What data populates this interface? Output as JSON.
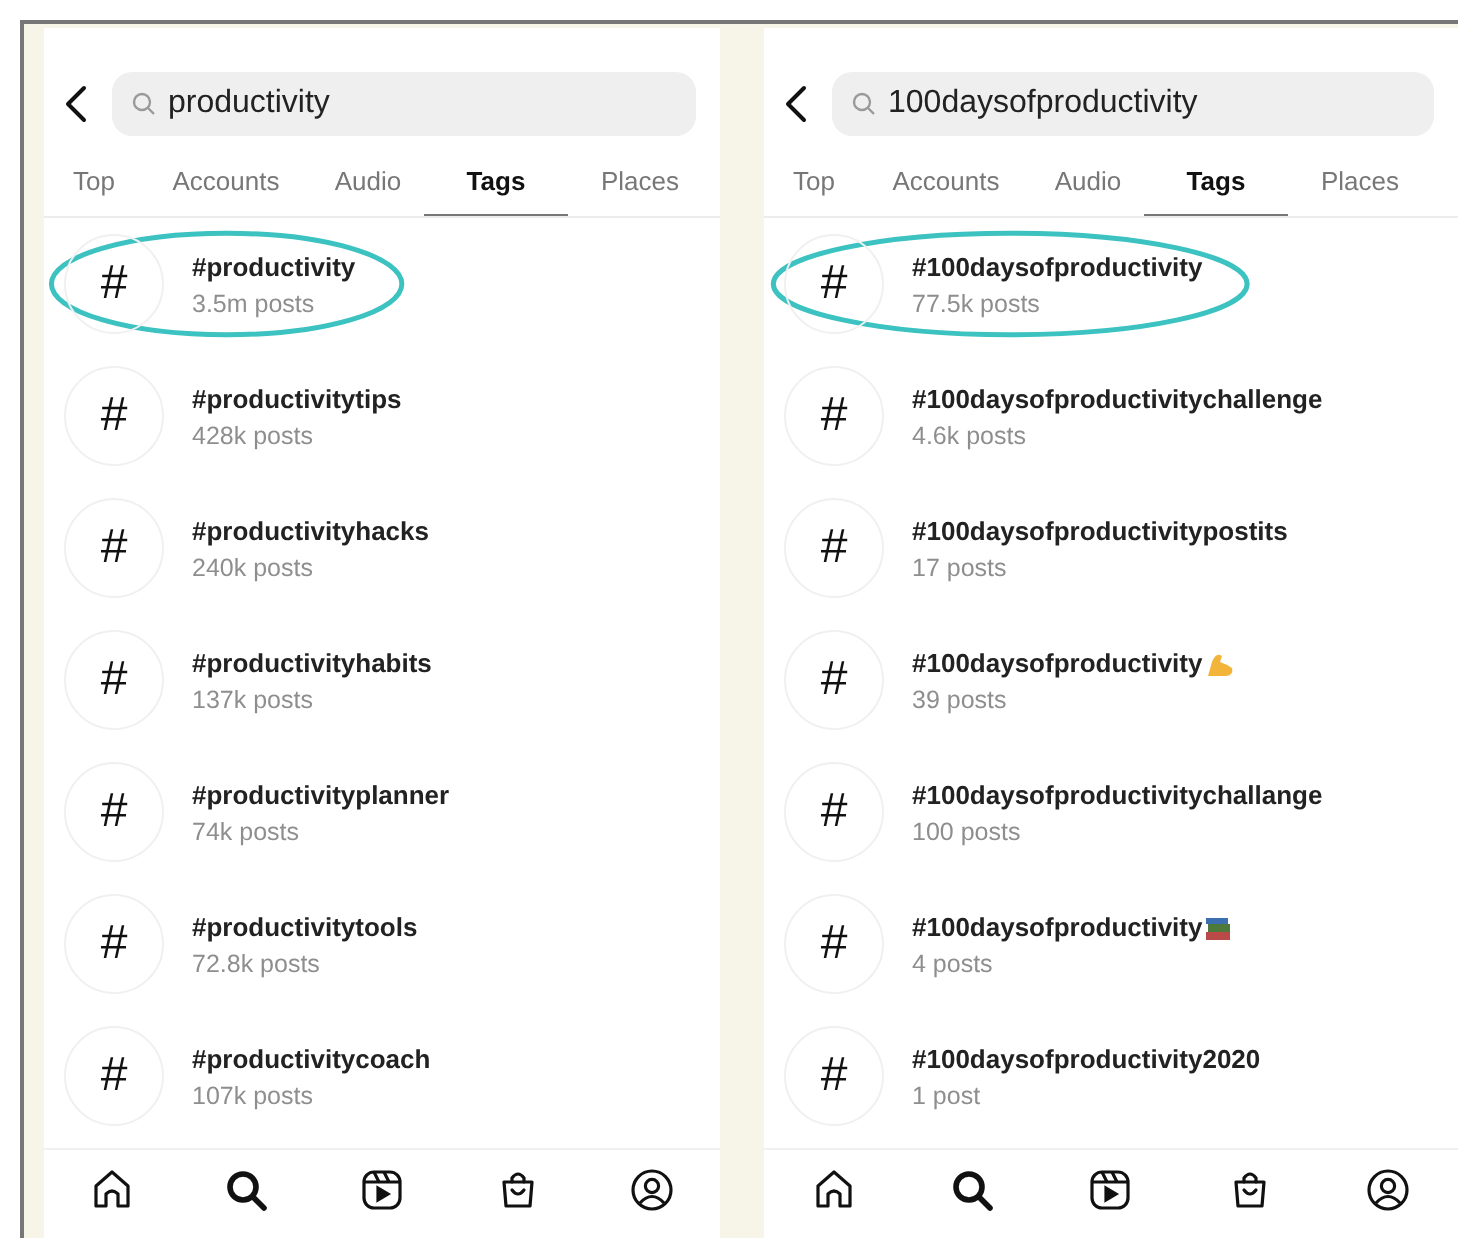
{
  "screens": [
    {
      "search": {
        "value": "productivity"
      },
      "tabs": [
        {
          "label": "Top",
          "selected": false
        },
        {
          "label": "Accounts",
          "selected": false
        },
        {
          "label": "Audio",
          "selected": false
        },
        {
          "label": "Tags",
          "selected": true
        },
        {
          "label": "Places",
          "selected": false
        }
      ],
      "tags": [
        {
          "symbol": "#",
          "name": "#productivity",
          "posts": "3.5m posts",
          "circled": true
        },
        {
          "symbol": "#",
          "name": "#productivitytips",
          "posts": "428k posts",
          "circled": false
        },
        {
          "symbol": "#",
          "name": "#productivityhacks",
          "posts": "240k posts",
          "circled": false
        },
        {
          "symbol": "#",
          "name": "#productivityhabits",
          "posts": "137k posts",
          "circled": false
        },
        {
          "symbol": "#",
          "name": "#productivityplanner",
          "posts": "74k posts",
          "circled": false
        },
        {
          "symbol": "#",
          "name": "#productivitytools",
          "posts": "72.8k posts",
          "circled": false
        },
        {
          "symbol": "#",
          "name": "#productivitycoach",
          "posts": "107k posts",
          "circled": false
        }
      ],
      "nav": [
        {
          "kind": "home"
        },
        {
          "kind": "search"
        },
        {
          "kind": "reels"
        },
        {
          "kind": "shop"
        },
        {
          "kind": "profile"
        }
      ]
    },
    {
      "search": {
        "value": "100daysofproductivity"
      },
      "tabs": [
        {
          "label": "Top",
          "selected": false
        },
        {
          "label": "Accounts",
          "selected": false
        },
        {
          "label": "Audio",
          "selected": false
        },
        {
          "label": "Tags",
          "selected": true
        },
        {
          "label": "Places",
          "selected": false
        }
      ],
      "tags": [
        {
          "symbol": "#",
          "name": "#100daysofproductivity",
          "posts": "77.5k posts",
          "circled": true
        },
        {
          "symbol": "#",
          "name": "#100daysofproductivitychallenge",
          "posts": "4.6k posts",
          "circled": false
        },
        {
          "symbol": "#",
          "name": "#100daysofproductivitypostits",
          "posts": "17 posts",
          "circled": false
        },
        {
          "symbol": "#",
          "name": "#100daysofproductivity",
          "kind": "arm",
          "posts": "39 posts",
          "circled": false
        },
        {
          "symbol": "#",
          "name": "#100daysofproductivitychallange",
          "posts": "100 posts",
          "circled": false
        },
        {
          "symbol": "#",
          "name": "#100daysofproductivity",
          "kind": "books",
          "posts": "4 posts",
          "circled": false
        },
        {
          "symbol": "#",
          "name": "#100daysofproductivity2020",
          "posts": "1 post",
          "circled": false
        }
      ],
      "nav": [
        {
          "kind": "home"
        },
        {
          "kind": "search"
        },
        {
          "kind": "reels"
        },
        {
          "kind": "shop"
        },
        {
          "kind": "profile"
        }
      ]
    }
  ]
}
